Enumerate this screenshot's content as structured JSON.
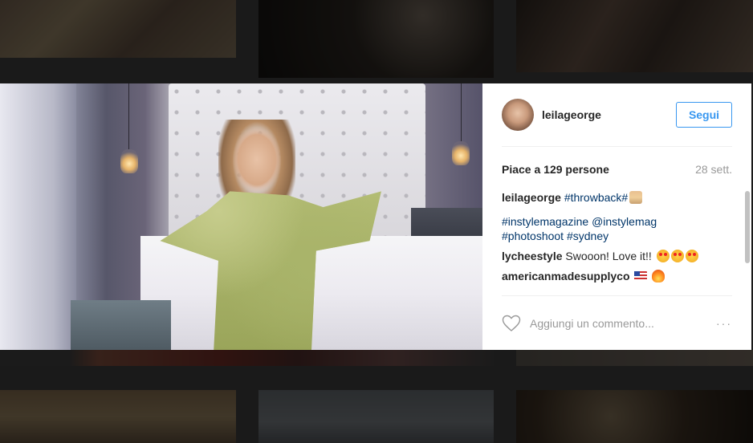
{
  "post": {
    "username": "leilageorge",
    "follow_label": "Segui",
    "likes": "Piace a 129 persone",
    "age": "28 sett.",
    "caption": {
      "author": "leilageorge",
      "tag1": "#throwback",
      "tag2": "#",
      "emoji": "woman-emoji",
      "tags_line2a": "#instylemagazine",
      "tags_line2b": "@instylemag",
      "tags_line3a": "#photoshoot",
      "tags_line3b": "#sydney"
    },
    "comments": [
      {
        "author": "lycheestyle",
        "text": "Swooon! Love it!!",
        "emoji": [
          "heart-eyes",
          "heart-eyes",
          "heart-eyes"
        ]
      },
      {
        "author": "americanmadesupplyco",
        "text": "",
        "emoji": [
          "us-flag",
          "fire"
        ]
      }
    ],
    "comment_placeholder": "Aggiungi un commento...",
    "more_label": "···"
  },
  "colors": {
    "link": "#003569",
    "accent": "#3897f0",
    "muted": "#999999",
    "text": "#262626"
  }
}
